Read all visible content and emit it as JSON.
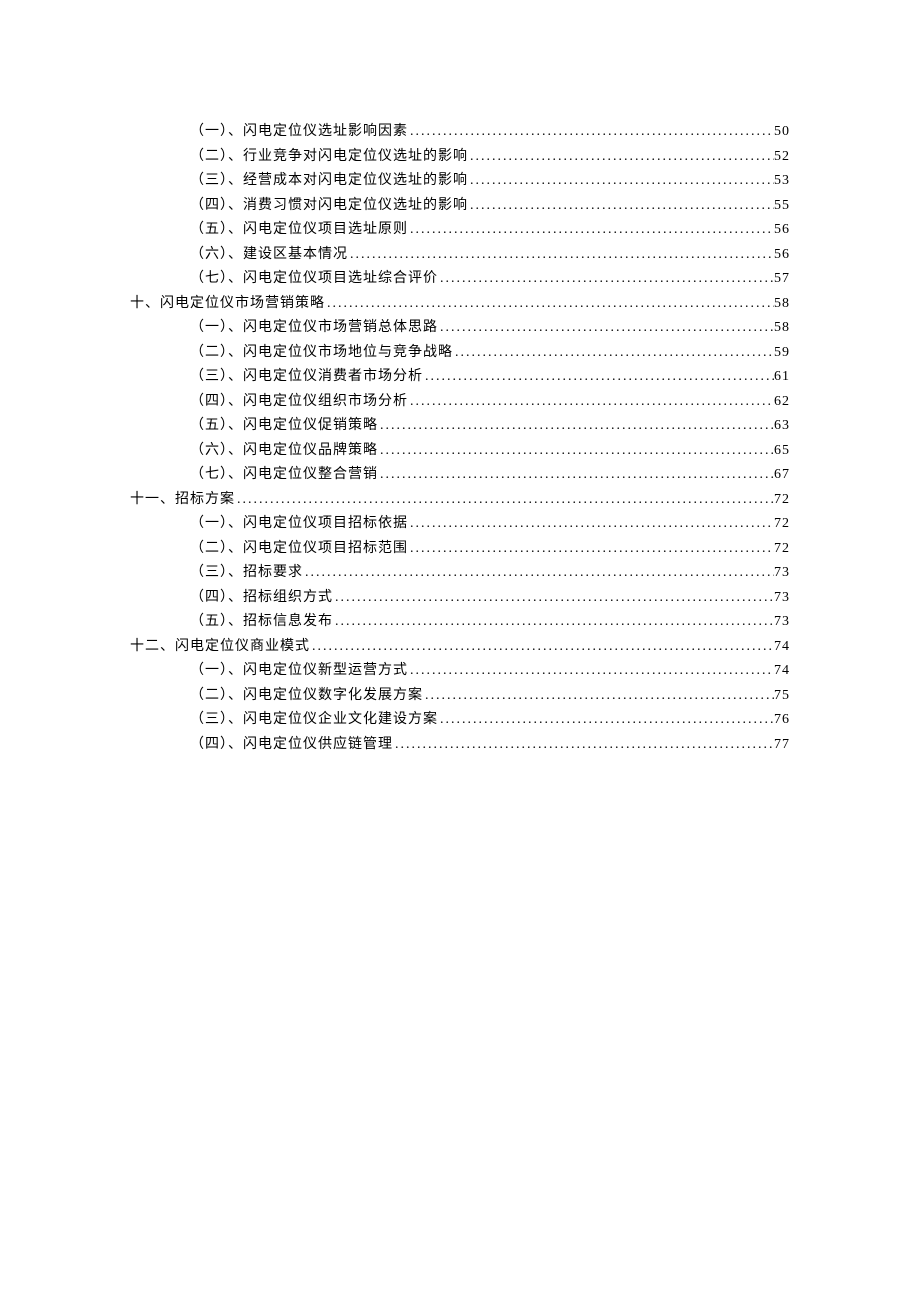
{
  "toc": [
    {
      "level": "sub",
      "label": "（一）、闪电定位仪选址影响因素",
      "page": "50"
    },
    {
      "level": "sub",
      "label": "（二）、行业竞争对闪电定位仪选址的影响",
      "page": "52"
    },
    {
      "level": "sub",
      "label": "（三）、经营成本对闪电定位仪选址的影响",
      "page": "53"
    },
    {
      "level": "sub",
      "label": "（四）、消费习惯对闪电定位仪选址的影响",
      "page": "55"
    },
    {
      "level": "sub",
      "label": "（五）、闪电定位仪项目选址原则",
      "page": "56"
    },
    {
      "level": "sub",
      "label": "（六）、建设区基本情况",
      "page": "56"
    },
    {
      "level": "sub",
      "label": "（七）、闪电定位仪项目选址综合评价",
      "page": "57"
    },
    {
      "level": "main",
      "label": "十、闪电定位仪市场营销策略",
      "page": "58"
    },
    {
      "level": "sub",
      "label": "（一）、闪电定位仪市场营销总体思路",
      "page": "58"
    },
    {
      "level": "sub",
      "label": "（二）、闪电定位仪市场地位与竞争战略",
      "page": "59"
    },
    {
      "level": "sub",
      "label": "（三）、闪电定位仪消费者市场分析",
      "page": "61"
    },
    {
      "level": "sub",
      "label": "（四）、闪电定位仪组织市场分析",
      "page": "62"
    },
    {
      "level": "sub",
      "label": "（五）、闪电定位仪促销策略",
      "page": "63"
    },
    {
      "level": "sub",
      "label": "（六）、闪电定位仪品牌策略",
      "page": "65"
    },
    {
      "level": "sub",
      "label": "（七）、闪电定位仪整合营销",
      "page": "67"
    },
    {
      "level": "main",
      "label": "十一、招标方案",
      "page": "72"
    },
    {
      "level": "sub",
      "label": "（一）、闪电定位仪项目招标依据",
      "page": "72"
    },
    {
      "level": "sub",
      "label": "（二）、闪电定位仪项目招标范围",
      "page": "72"
    },
    {
      "level": "sub",
      "label": "（三）、招标要求",
      "page": "73"
    },
    {
      "level": "sub",
      "label": "（四）、招标组织方式",
      "page": "73"
    },
    {
      "level": "sub",
      "label": "（五）、招标信息发布",
      "page": "73"
    },
    {
      "level": "main",
      "label": "十二、闪电定位仪商业模式",
      "page": "74"
    },
    {
      "level": "sub",
      "label": "（一）、闪电定位仪新型运营方式",
      "page": "74"
    },
    {
      "level": "sub",
      "label": "（二）、闪电定位仪数字化发展方案",
      "page": "75"
    },
    {
      "level": "sub",
      "label": "（三）、闪电定位仪企业文化建设方案",
      "page": "76"
    },
    {
      "level": "sub",
      "label": "（四）、闪电定位仪供应链管理",
      "page": "77"
    }
  ]
}
